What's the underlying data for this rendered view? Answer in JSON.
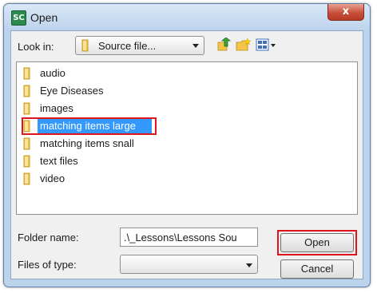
{
  "window": {
    "app_icon_text": "SC",
    "title": "Open",
    "close_glyph": "x"
  },
  "toolbar": {
    "look_in_label": "Look in:",
    "look_in_value": "Source file...",
    "icons": [
      "up-one-level-icon",
      "new-folder-icon",
      "view-menu-icon"
    ]
  },
  "files": [
    {
      "name": "audio",
      "icon": "folder-icon",
      "selected": false
    },
    {
      "name": "Eye Diseases",
      "icon": "folder-icon",
      "selected": false
    },
    {
      "name": "images",
      "icon": "folder-icon",
      "selected": false
    },
    {
      "name": "matching items large",
      "icon": "folder-icon",
      "selected": true
    },
    {
      "name": "matching items snall",
      "icon": "folder-icon",
      "selected": false
    },
    {
      "name": "text files",
      "icon": "folder-icon",
      "selected": false
    },
    {
      "name": "video",
      "icon": "folder-icon",
      "selected": false
    }
  ],
  "footer": {
    "folder_name_label": "Folder name:",
    "folder_name_value": ".\\_Lessons\\Lessons Sou",
    "files_of_type_label": "Files of type:",
    "files_of_type_value": "",
    "open_label": "Open",
    "cancel_label": "Cancel"
  },
  "colors": {
    "selection": "#3399ff",
    "highlight_box": "#e0151b",
    "frame": "#bcd3ec"
  }
}
